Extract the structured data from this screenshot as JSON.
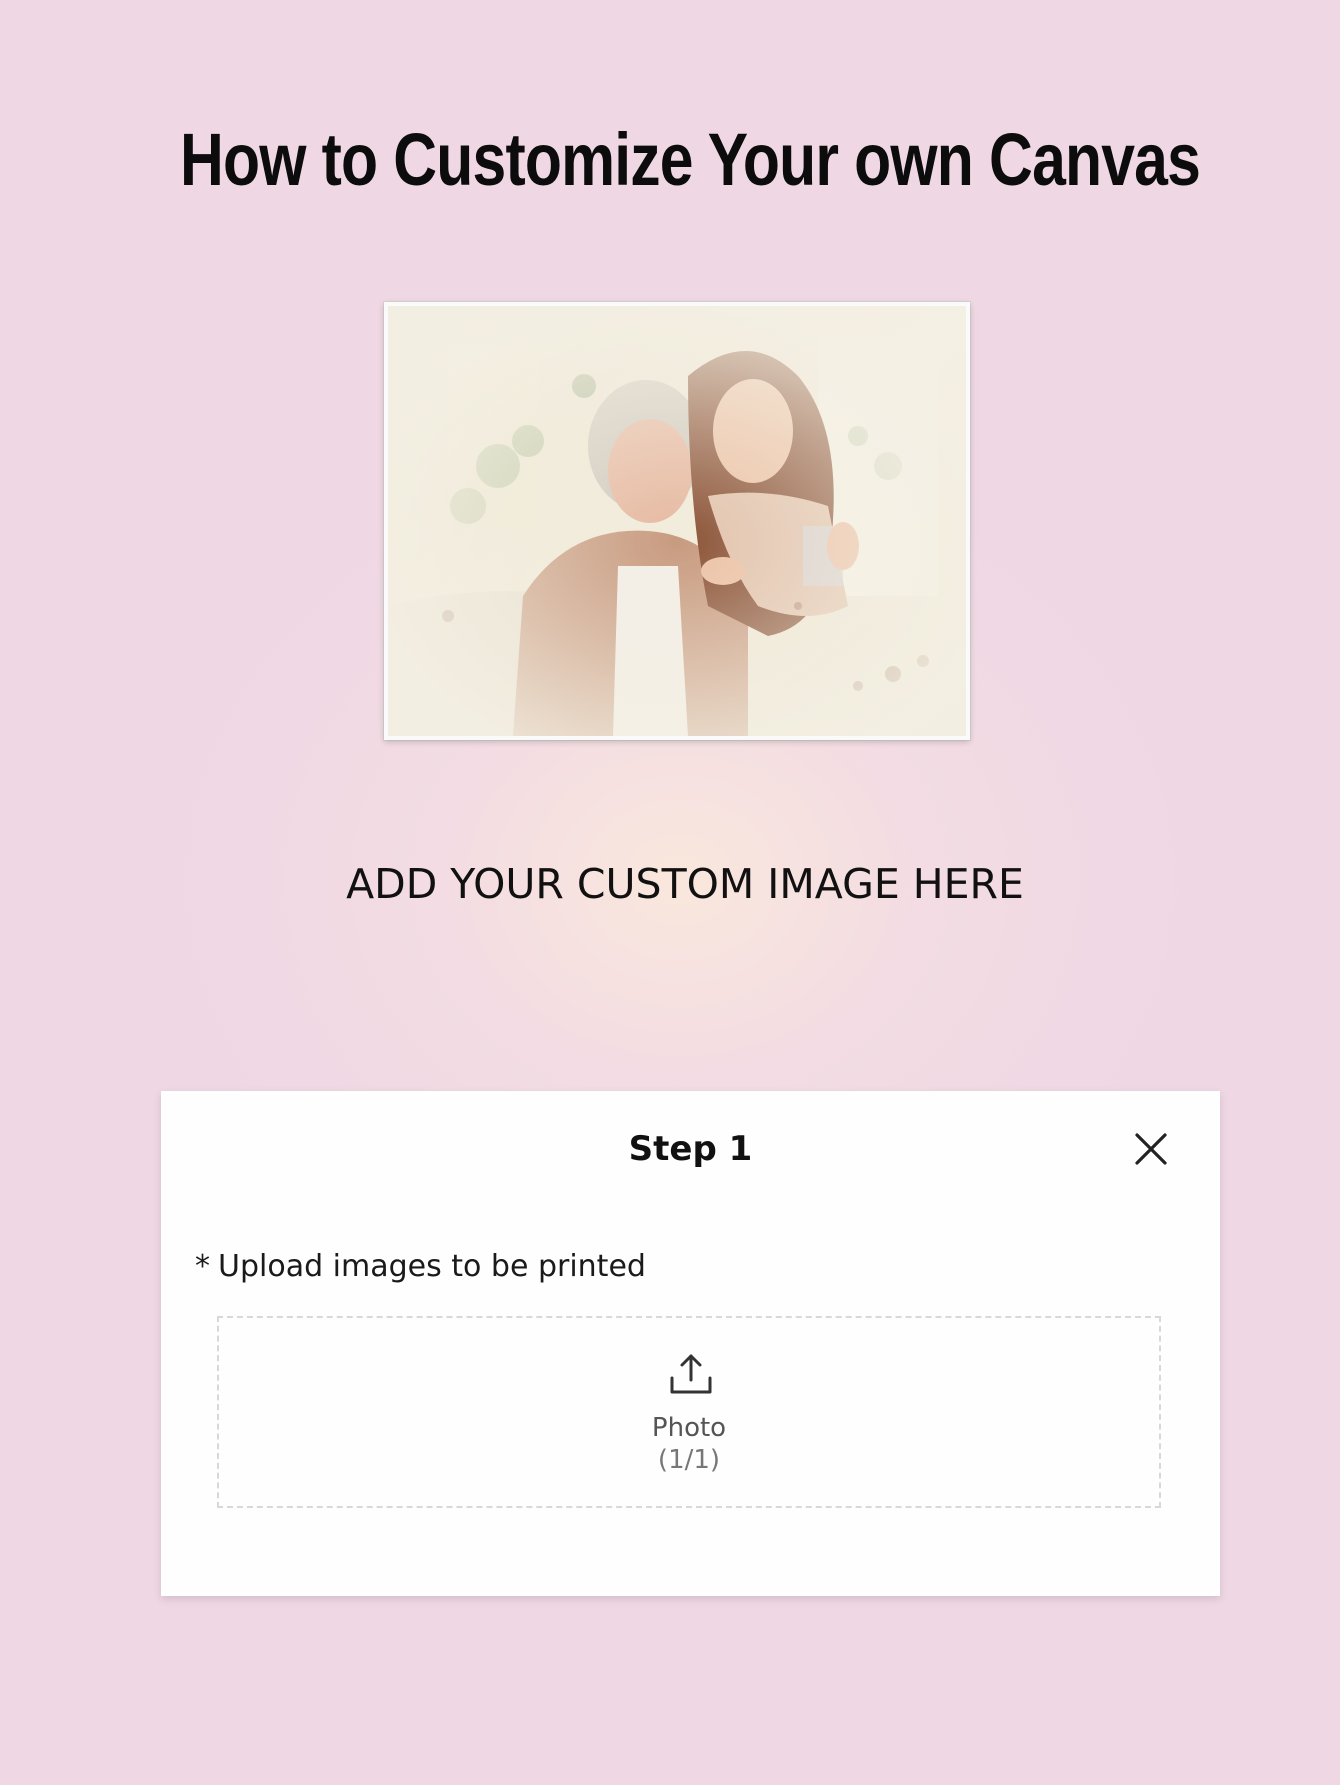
{
  "page": {
    "title": "How to Customize Your own Canvas",
    "instruction": "ADD YOUR CUSTOM IMAGE HERE"
  },
  "preview": {
    "icon": "canvas-photo-image"
  },
  "dialog": {
    "title": "Step 1",
    "close_icon": "close-icon",
    "required_mark": "*",
    "upload_label": "Upload images to be printed",
    "dropzone": {
      "icon": "upload-icon",
      "label": "Photo",
      "count": "(1/1)"
    }
  },
  "colors": {
    "background": "#efd7e4",
    "dialog_background": "#fefefe",
    "text": "#111111"
  }
}
